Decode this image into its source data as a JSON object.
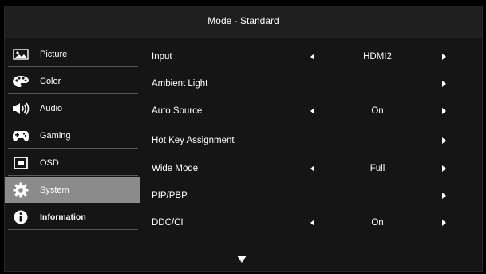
{
  "header": {
    "title": "Mode - Standard"
  },
  "sidebar": {
    "items": [
      {
        "label": "Picture",
        "icon": "picture-icon"
      },
      {
        "label": "Color",
        "icon": "palette-icon"
      },
      {
        "label": "Audio",
        "icon": "speaker-icon"
      },
      {
        "label": "Gaming",
        "icon": "gamepad-icon"
      },
      {
        "label": "OSD",
        "icon": "osd-icon"
      },
      {
        "label": "System",
        "icon": "gear-icon",
        "selected": true
      },
      {
        "label": "Information",
        "icon": "info-icon"
      }
    ]
  },
  "settings": {
    "rows": [
      {
        "label": "Input",
        "value": "HDMI2"
      },
      {
        "label": "Ambient Light",
        "value": ""
      },
      {
        "label": "Auto Source",
        "value": "On"
      },
      {
        "label": "Hot Key Assignment",
        "value": ""
      },
      {
        "label": "Wide Mode",
        "value": "Full"
      },
      {
        "label": "PIP/PBP",
        "value": ""
      },
      {
        "label": "DDC/CI",
        "value": "On"
      }
    ]
  },
  "colors": {
    "selected_bg": "#8b8b8b",
    "panel_bg": "#151515"
  }
}
